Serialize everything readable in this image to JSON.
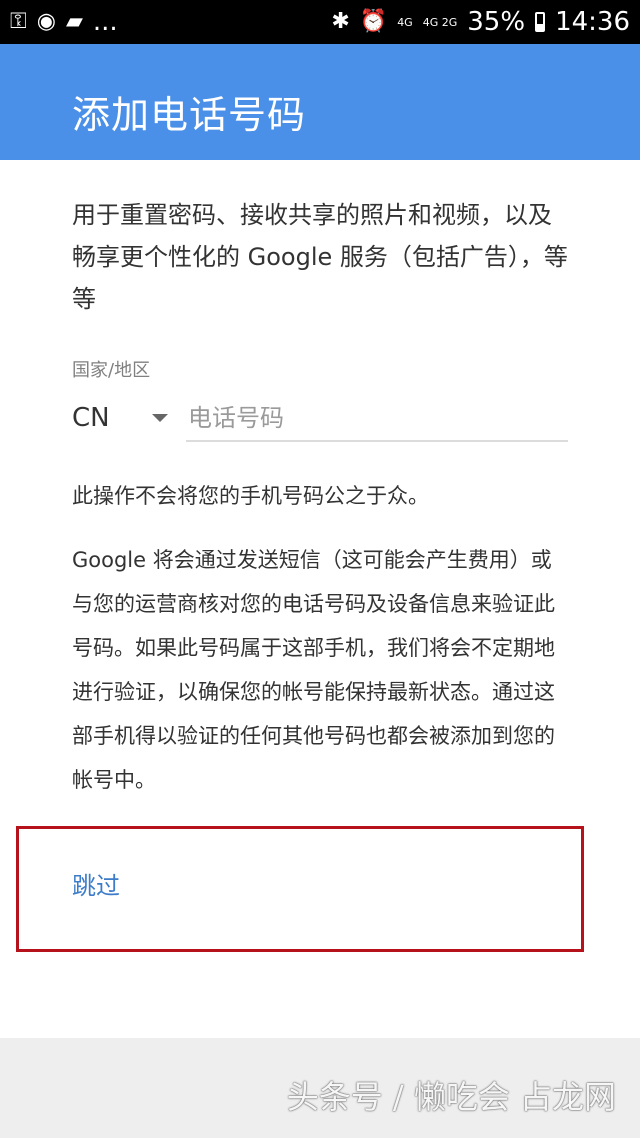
{
  "status_bar": {
    "left_icons": [
      "key-icon",
      "whatsapp-icon",
      "message-icon"
    ],
    "more_label": "...",
    "signals": [
      "4G",
      "4G 2G"
    ],
    "battery_percent": "35%",
    "time": "14:36"
  },
  "app_bar": {
    "title": "添加电话号码"
  },
  "content": {
    "intro": "用于重置密码、接收共享的照片和视频，以及畅享更个性化的 Google 服务（包括广告），等等",
    "country_label": "国家/地区",
    "country_value": "CN",
    "phone_placeholder": "电话号码",
    "phone_value": "",
    "privacy_note": "此操作不会将您的手机号码公之于众。",
    "verify_note": "Google 将会通过发送短信（这可能会产生费用）或与您的运营商核对您的电话号码及设备信息来验证此号码。如果此号码属于这部手机，我们将会不定期地进行验证，以确保您的帐号能保持最新状态。通过这部手机得以验证的任何其他号码也都会被添加到您的帐号中。",
    "skip_label": "跳过"
  },
  "colors": {
    "app_bar": "#4a8fe8",
    "link": "#3d7cc8",
    "highlight": "#b5121b"
  },
  "watermark": "头条号 / 懒吃会 占龙网"
}
